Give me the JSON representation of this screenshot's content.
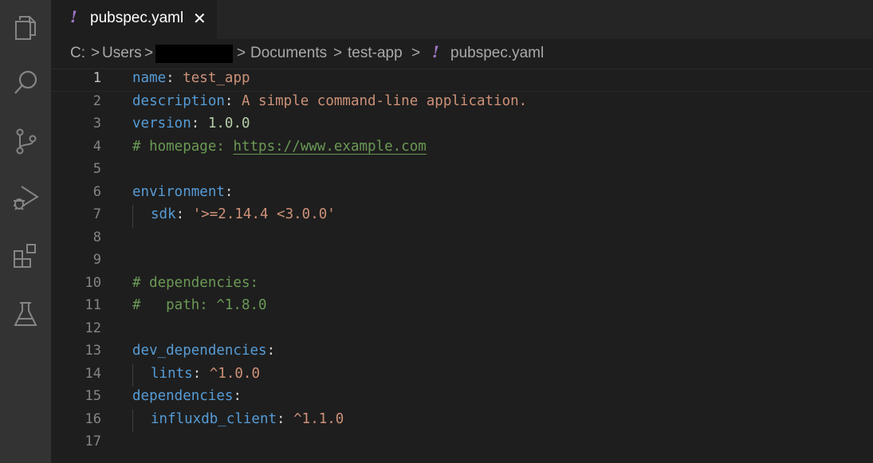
{
  "tab": {
    "icon": "!",
    "label": "pubspec.yaml",
    "close": "✕"
  },
  "breadcrumb": {
    "parts": [
      "C:",
      "Users",
      "Documents",
      "test-app",
      "pubspec.yaml"
    ],
    "sep": ">",
    "file_icon": "!"
  },
  "editor": {
    "lines": [
      {
        "num": "1",
        "key": "name",
        "colon": ": ",
        "value": "test_app",
        "vtype": "s"
      },
      {
        "num": "2",
        "key": "description",
        "colon": ": ",
        "value": "A simple command-line application.",
        "vtype": "s"
      },
      {
        "num": "3",
        "key": "version",
        "colon": ": ",
        "value": "1.0.0",
        "vtype": "n"
      },
      {
        "num": "4",
        "comment_prefix": "# homepage: ",
        "url": "https://www.example.com"
      },
      {
        "num": "5"
      },
      {
        "num": "6",
        "key": "environment",
        "colon": ":"
      },
      {
        "num": "7",
        "key": "sdk",
        "colon": ": ",
        "value": "'>=2.14.4 <3.0.0'",
        "vtype": "s",
        "indent": true
      },
      {
        "num": "8"
      },
      {
        "num": "9"
      },
      {
        "num": "10",
        "comment": "# dependencies:"
      },
      {
        "num": "11",
        "comment": "#   path: ^1.8.0"
      },
      {
        "num": "12"
      },
      {
        "num": "13",
        "key": "dev_dependencies",
        "colon": ":"
      },
      {
        "num": "14",
        "key": "lints",
        "colon": ": ",
        "value": "^1.0.0",
        "vtype": "s",
        "indent": true
      },
      {
        "num": "15",
        "key": "dependencies",
        "colon": ":"
      },
      {
        "num": "16",
        "key": "influxdb_client",
        "colon": ": ",
        "value": "^1.1.0",
        "vtype": "s",
        "indent": true
      },
      {
        "num": "17"
      }
    ]
  },
  "activity_bar": {
    "icons": [
      "explorer-icon",
      "search-icon",
      "source-control-icon",
      "run-debug-icon",
      "extensions-icon",
      "testing-icon"
    ]
  },
  "colors": {
    "key": "#569cd6",
    "string": "#ce9178",
    "number": "#b5cea8",
    "comment": "#6a9955",
    "yaml_icon": "#a074c4"
  }
}
